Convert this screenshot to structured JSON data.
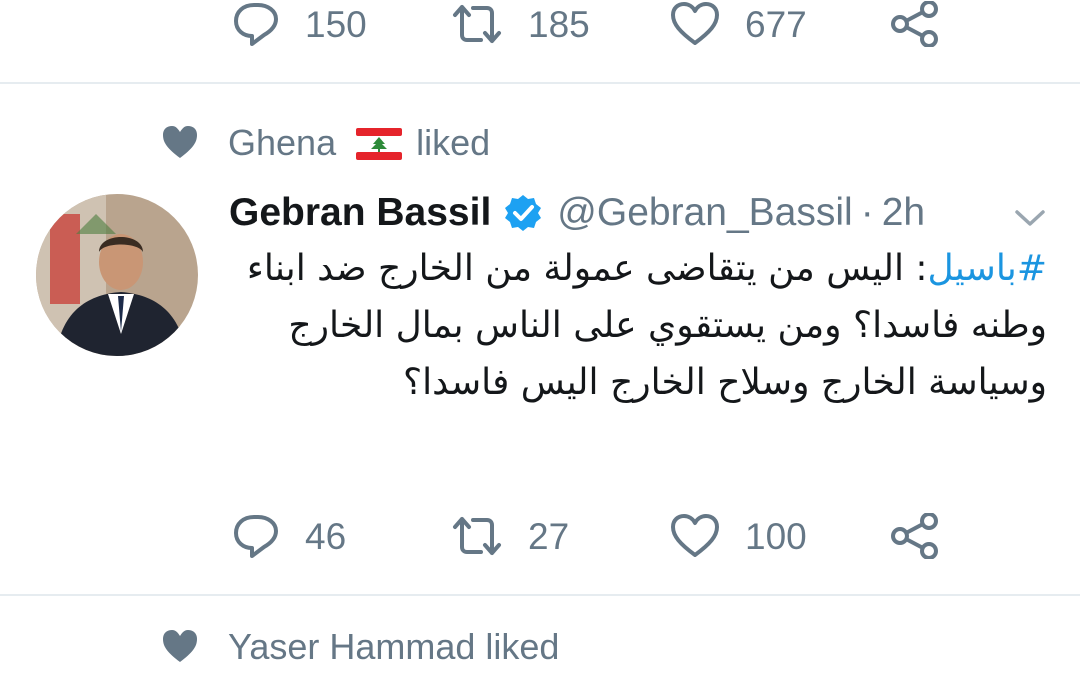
{
  "top_tweet": {
    "actions": {
      "reply_count": "150",
      "retweet_count": "185",
      "like_count": "677"
    }
  },
  "liked_tweet": {
    "social_context": {
      "user": "Ghena",
      "flag_emoji": "🇱🇧",
      "action": "liked"
    },
    "author": {
      "name": "Gebran Bassil",
      "handle": "@Gebran_Bassil",
      "separator": "·",
      "time": "2h"
    },
    "text": {
      "hashtag": "#باسيل",
      "body": ": اليس من يتقاضى عمولة من الخارج ضد ابناء وطنه فاسدا؟ ومن يستقوي على الناس بمال الخارج وسياسة الخارج وسلاح الخارج اليس فاسدا؟"
    },
    "actions": {
      "reply_count": "46",
      "retweet_count": "27",
      "like_count": "100"
    }
  },
  "next_item": {
    "social_context": {
      "text": "Yaser Hammad liked"
    }
  },
  "colors": {
    "secondary_text": "#657786",
    "link": "#1b95e0",
    "verified": "#1da1f2",
    "divider": "#e6ecf0"
  },
  "icons": {
    "reply": "reply-icon",
    "retweet": "retweet-icon",
    "like": "heart-icon",
    "share": "share-icon",
    "verified": "verified-badge-icon",
    "caret": "chevron-down-icon"
  }
}
